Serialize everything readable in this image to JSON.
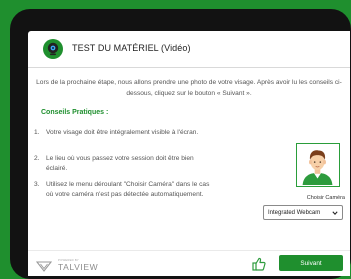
{
  "header": {
    "title": "TEST DU MATÉRIEL (Vidéo)",
    "logo_icon": "webcam-icon"
  },
  "intro": {
    "text": "Lors de la prochaine étape, nous allons prendre une photo de votre visage. Après avoir lu les conseils ci-dessous, cliquez sur le bouton « Suivant »."
  },
  "conseils": {
    "heading": "Conseils Pratiques :",
    "items": [
      {
        "num": "1.",
        "text": "Votre visage doit être intégralement visible à l'écran."
      },
      {
        "num": "2.",
        "text": "Le lieu où vous passez votre session doit être bien éclairé."
      },
      {
        "num": "3.",
        "text": "Utilisez le menu déroulant \"Choisir Caméra\" dans le cas où votre caméra n'est pas détectée automatiquement."
      }
    ]
  },
  "camera": {
    "label": "Choisir Caméra",
    "selected": "Integrated Webcam",
    "avatar_icon": "person-avatar-icon"
  },
  "footer": {
    "brand_small": "POWERED BY",
    "brand_name": "TALVIEW",
    "thumb_icon": "thumbs-up-icon",
    "next_label": "Suivant"
  },
  "colors": {
    "accent": "#1f8f2e",
    "background": "#1f8f2e",
    "device": "#121212"
  }
}
